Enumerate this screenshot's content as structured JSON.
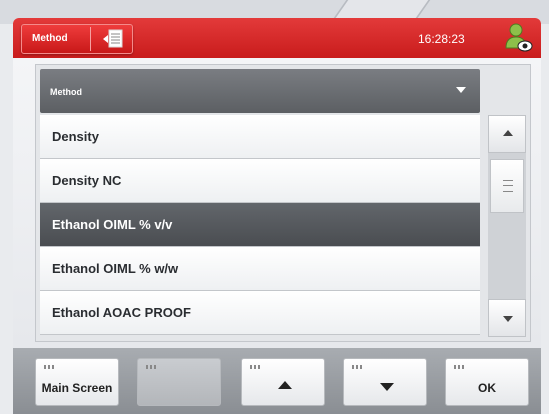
{
  "topbar": {
    "method_label": "Method",
    "time": "16:28:23",
    "doc_icon": "document-list-icon",
    "user_icon": "user-eye-icon"
  },
  "list": {
    "header_label": "Method",
    "items": [
      {
        "label": "Density",
        "selected": false
      },
      {
        "label": "Density NC",
        "selected": false
      },
      {
        "label": "Ethanol OIML  % v/v",
        "selected": true
      },
      {
        "label": "Ethanol OIML  % w/w",
        "selected": false
      },
      {
        "label": "Ethanol AOAC PROOF",
        "selected": false
      }
    ]
  },
  "softkeys": {
    "main_screen": "Main Screen",
    "blank": "",
    "up_icon": "arrow-up-icon",
    "down_icon": "arrow-down-icon",
    "ok": "OK"
  },
  "colors": {
    "brand_red": "#d42828",
    "selected_row": "#55585c"
  }
}
